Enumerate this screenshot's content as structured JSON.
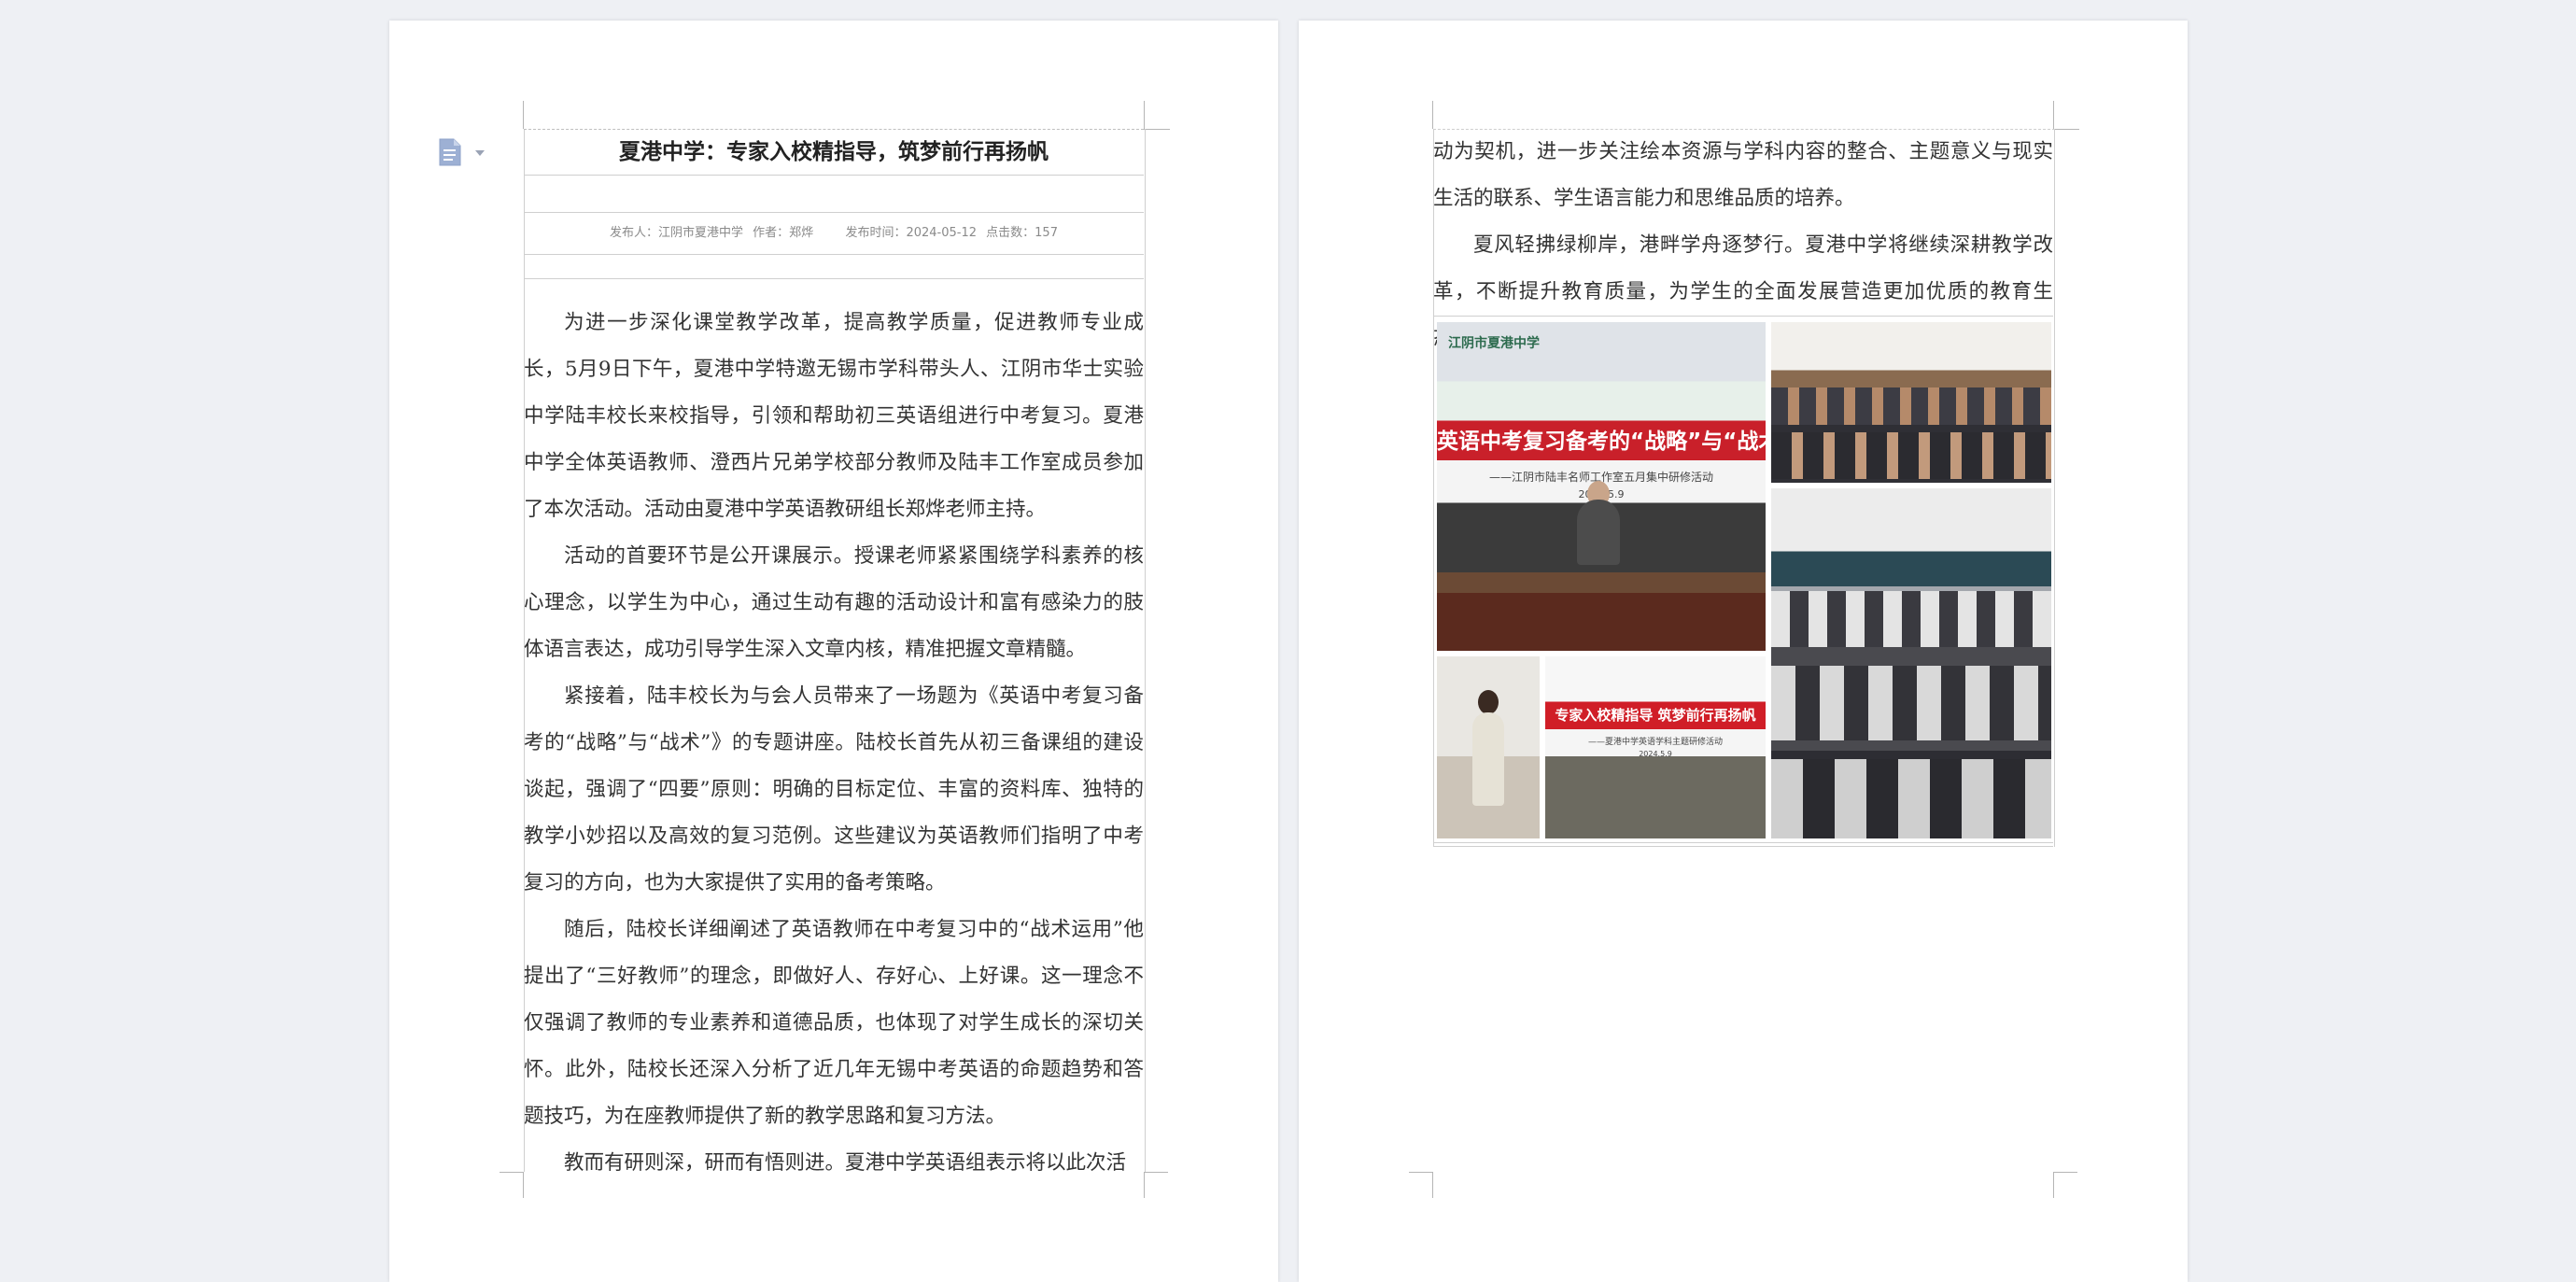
{
  "document": {
    "title": "夏港中学：专家入校精指导，筑梦前行再扬帆",
    "meta": {
      "publisher": "发布人：江阴市夏港中学",
      "author": "作者：郑烨",
      "publish_time": "发布时间：2024-05-12",
      "clicks": "点击数：157"
    },
    "page1_paragraphs": [
      "为进一步深化课堂教学改革，提高教学质量，促进教师专业成长，5月9日下午，夏港中学特邀无锡市学科带头人、江阴市华士实验中学陆丰校长来校指导，引领和帮助初三英语组进行中考复习。夏港中学全体英语教师、澄西片兄弟学校部分教师及陆丰工作室成员参加了本次活动。活动由夏港中学英语教研组长郑烨老师主持。",
      "活动的首要环节是公开课展示。授课老师紧紧围绕学科素养的核心理念，以学生为中心，通过生动有趣的活动设计和富有感染力的肢体语言表达，成功引导学生深入文章内核，精准把握文章精髓。",
      "紧接着，陆丰校长为与会人员带来了一场题为《英语中考复习备考的“战略”与“战术”》的专题讲座。陆校长首先从初三备课组的建设谈起，强调了“四要”原则：明确的目标定位、丰富的资料库、独特的教学小妙招以及高效的复习范例。这些建议为英语教师们指明了中考复习的方向，也为大家提供了实用的备考策略。",
      "随后，陆校长详细阐述了英语教师在中考复习中的“战术运用”他提出了“三好教师”的理念，即做好人、存好心、上好课。这一理念不仅强调了教师的专业素养和道德品质，也体现了对学生成长的深切关怀。此外，陆校长还深入分析了近几年无锡中考英语的命题趋势和答题技巧，为在座教师提供了新的教学思路和复习方法。",
      "教而有研则深，研而有悟则进。夏港中学英语组表示将以此次活"
    ],
    "page2_paragraphs": [
      "动为契机，进一步关注绘本资源与学科内容的整合、主题意义与现实生活的联系、学生语言能力和思维品质的培养。",
      "夏风轻拂绿柳岸，港畔学舟逐梦行。夏港中学将继续深耕教学改革，不断提升教育质量，为学生的全面发展营造更加优质的教育生态。"
    ],
    "photos": {
      "banner_school": "江阴市夏港中学",
      "banner_title": "英语中考复习备考的“战略”与“战术”",
      "banner_subtitle": "——江阴市陆丰名师工作室五月集中研修活动",
      "banner_date": "2024.5.9",
      "banner2_title": "专家入校精指导  筑梦前行再扬帆",
      "banner2_subtitle": "——夏港中学英语学科主题研修活动",
      "banner2_date": "2024.5.9"
    }
  },
  "icons": {
    "document_icon": "document-icon",
    "dropdown": "chevron-down-icon"
  },
  "colors": {
    "background": "#eef0f4",
    "page": "#ffffff",
    "banner_red": "#c9202a"
  }
}
